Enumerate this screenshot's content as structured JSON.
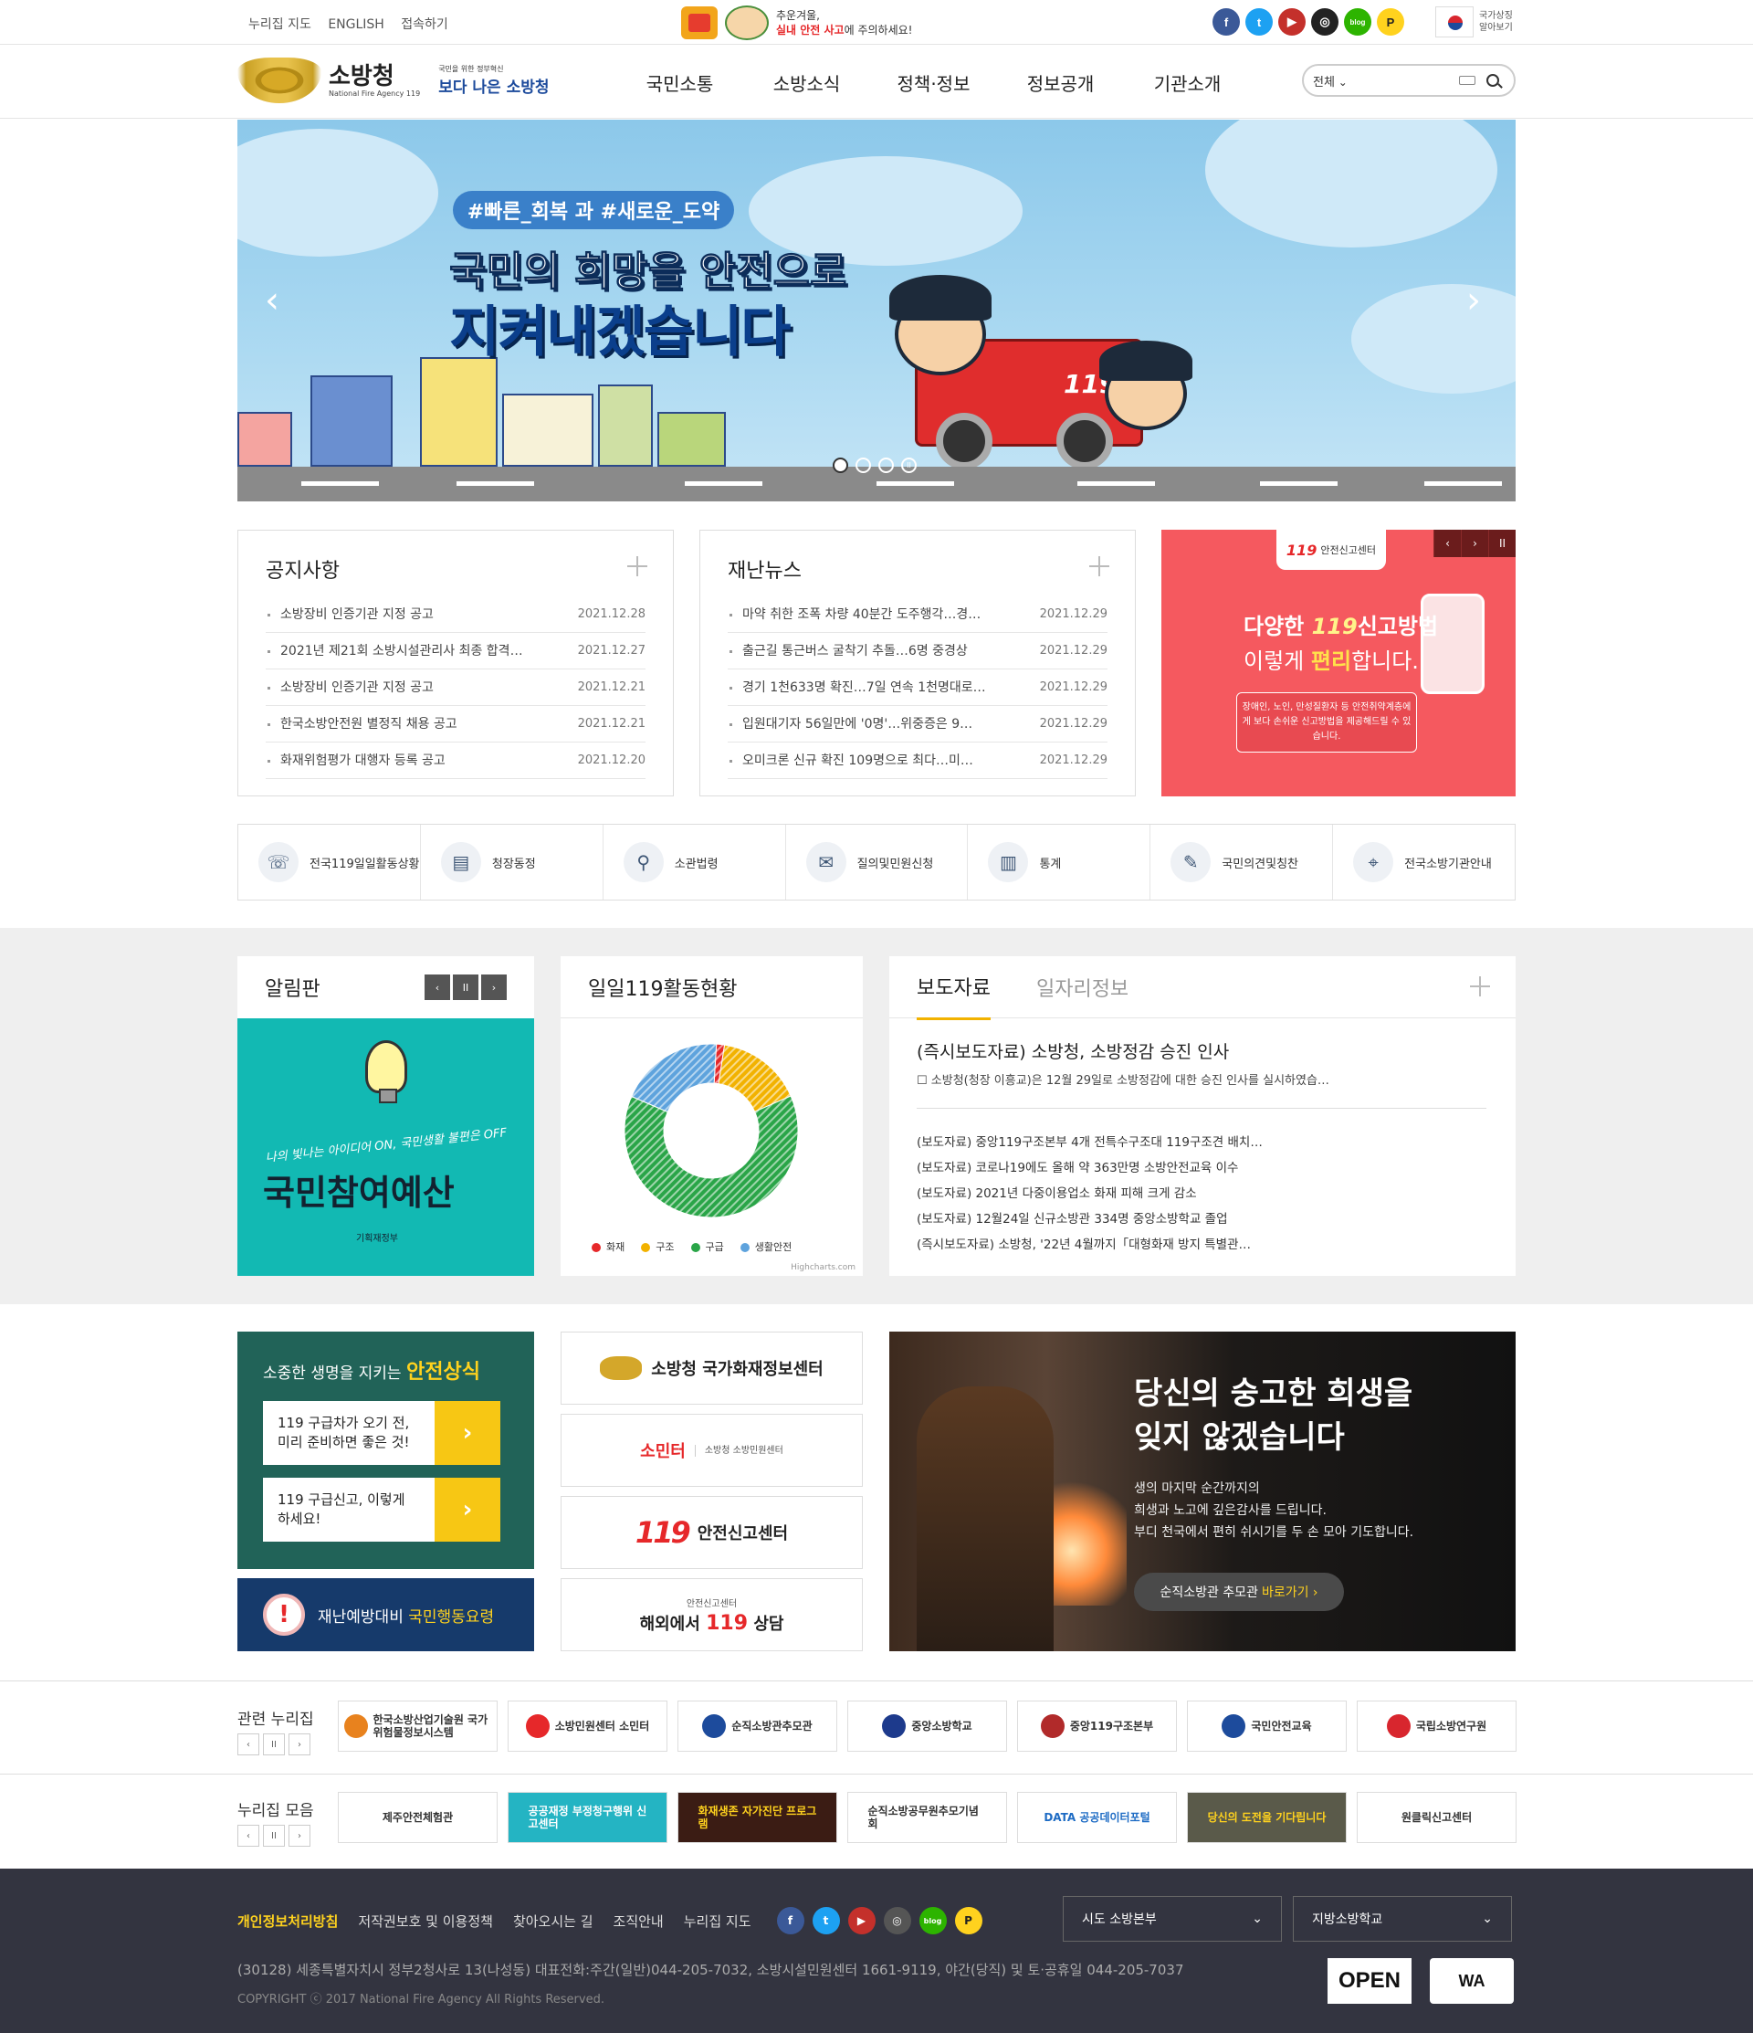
{
  "top": {
    "links": [
      "누리집 지도",
      "ENGLISH",
      "접속하기"
    ],
    "banner_line1": "추운겨울,",
    "banner_line2_red": "실내 안전 사고",
    "banner_line2_rest": "에 주의하세요!",
    "sns": [
      "f",
      "t",
      "▶",
      "◎",
      "blog",
      "P"
    ],
    "national_symbol": "국가상징 알아보기"
  },
  "header": {
    "logo_ko": "소방청",
    "logo_en": "National Fire Agency 119",
    "slogan_small": "국민을 위한 정부혁신",
    "slogan": "보다 나은 소방청",
    "menu": [
      "국민소통",
      "소방소식",
      "정책·정보",
      "정보공개",
      "기관소개"
    ],
    "search_scope": "전체",
    "search_placeholder": ""
  },
  "hero": {
    "tag": "#빠른_회복 과 #새로운_도약",
    "line1": "국민의 희망을 안전으로",
    "line2": "지켜내겠습니다",
    "prev": "‹",
    "next": "›",
    "truck_label": "119"
  },
  "notices": {
    "title": "공지사항",
    "items": [
      {
        "t": "소방장비 인증기관 지정 공고",
        "d": "2021.12.28"
      },
      {
        "t": "2021년 제21회 소방시설관리사 최종 합격…",
        "d": "2021.12.27"
      },
      {
        "t": "소방장비 인증기관 지정 공고",
        "d": "2021.12.21"
      },
      {
        "t": "한국소방안전원 별정직 채용 공고",
        "d": "2021.12.21"
      },
      {
        "t": "화재위험평가 대행자 등록 공고",
        "d": "2021.12.20"
      }
    ]
  },
  "news": {
    "title": "재난뉴스",
    "items": [
      {
        "t": "마약 취한 조폭 차량 40분간 도주행각…경…",
        "d": "2021.12.29"
      },
      {
        "t": "출근길 통근버스 굴착기 추돌…6명 중경상",
        "d": "2021.12.29"
      },
      {
        "t": "경기 1천633명 확진…7일 연속 1천명대로…",
        "d": "2021.12.29"
      },
      {
        "t": "입원대기자 56일만에 '0명'…위중증은 9…",
        "d": "2021.12.29"
      },
      {
        "t": "오미크론 신규 확진 109명으로 최다…미…",
        "d": "2021.12.29"
      }
    ]
  },
  "promo": {
    "badge_num": "119",
    "badge": "안전신고센터",
    "line1_a": "다양한",
    "line1_num": "119",
    "line1_b": "신고방법",
    "line2_a": "이렇게",
    "line2_hl": "편리",
    "line2_b": "합니다.",
    "box": "장애인, 노인, 만성질환자 등 안전취약계층에게 보다 손쉬운 신고방법을 제공해드릴 수 있습니다.",
    "ctrl": [
      "‹",
      "›",
      "II"
    ]
  },
  "quick": [
    {
      "icon": "☏",
      "label": "전국119일일활동상황"
    },
    {
      "icon": "▤",
      "label": "청장동정"
    },
    {
      "icon": "⚲",
      "label": "소관법령"
    },
    {
      "icon": "✉",
      "label": "질의및민원신청"
    },
    {
      "icon": "▥",
      "label": "통계"
    },
    {
      "icon": "✎",
      "label": "국민의견및칭찬"
    },
    {
      "icon": "⌖",
      "label": "전국소방기관안내"
    }
  ],
  "board": {
    "title": "알림판",
    "ctrl": [
      "‹",
      "II",
      "›"
    ],
    "sub": "나의 빛나는 아이디어 ON, 국민생활 불편은 OFF",
    "main": "국민참여예산",
    "org": "기획재정부"
  },
  "activity": {
    "title": "일일119활동현황",
    "credit": "Highcharts.com"
  },
  "chart_data": {
    "type": "pie",
    "title": "",
    "donut": true,
    "categories": [
      "화재",
      "구조",
      "구급",
      "생활안전"
    ],
    "values": [
      1.5,
      16,
      63,
      19.5
    ],
    "colors": [
      "#e6282a",
      "#f2b200",
      "#2aa548",
      "#5ea3dd"
    ]
  },
  "press": {
    "tab_active": "보도자료",
    "tab_inactive": "일자리정보",
    "headline": "(즉시보도자료) 소방청, 소방정감 승진 인사",
    "summary": "☐ 소방청(청장 이흥교)은 12월 29일로 소방정감에 대한 승진 인사를 실시하였습…",
    "items": [
      "(보도자료) 중앙119구조본부 4개 전특수구조대 119구조견 배치…",
      "(보도자료) 코로나19에도 올해 약 363만명 소방안전교육 이수",
      "(보도자료) 2021년 다중이용업소 화재 피해 크게 감소",
      "(보도자료) 12월24일 신규소방관 334명 중앙소방학교 졸업",
      "(즉시보도자료) 소방청, '22년 4월까지「대형화재 방지 특별관…"
    ]
  },
  "safety": {
    "title_a": "소중한 생명을 지키는",
    "title_b": "안전상식",
    "items": [
      {
        "text": "119 구급차가 오기 전, 미리 준비하면 좋은 것!",
        "go": "›"
      },
      {
        "text": "119 구급신고, 이렇게 하세요!",
        "go": "›"
      }
    ]
  },
  "disaster": {
    "mark": "!",
    "a": "재난예방대비",
    "b": "국민행동요령"
  },
  "link_banners": {
    "fire_info": "소방청 국가화재정보센터",
    "somin": "소민터",
    "somin_sub": "소방청 소방민원센터",
    "safety119_num": "119",
    "safety119": "안전신고센터",
    "overseas_small": "안전신고센터",
    "overseas_a": "해외에서",
    "overseas_num": "119",
    "overseas_b": "상담"
  },
  "memorial": {
    "line1": "당신의 숭고한 희생을",
    "line2": "잊지 않겠습니다",
    "body1": "생의 마지막 순간까지의",
    "body2": "희생과 노고에 깊은감사를 드립니다.",
    "body3": "부디 천국에서 편히 쉬시기를 두 손 모아 기도합니다.",
    "btn_a": "순직소방관 추모관",
    "btn_b": "바로가기 ›"
  },
  "related": {
    "title": "관련 누리집",
    "ctrl": [
      "‹",
      "II",
      "›"
    ],
    "items": [
      {
        "label": "한국소방산업기술원 국가위험물정보시스템",
        "color": "#e8821e"
      },
      {
        "label": "소방민원센터 소민터",
        "color": "#e6282a"
      },
      {
        "label": "순직소방관추모관",
        "color": "#1d4b9c"
      },
      {
        "label": "중앙소방학교",
        "color": "#1d3a8c"
      },
      {
        "label": "중앙119구조본부",
        "color": "#b12a2a"
      },
      {
        "label": "국민안전교육",
        "color": "#1d4b9c"
      },
      {
        "label": "국립소방연구원",
        "color": "#d8262e"
      }
    ]
  },
  "collection": {
    "title": "누리집 모음",
    "ctrl": [
      "‹",
      "II",
      "›"
    ],
    "items": [
      {
        "label": "제주안전체험관",
        "bg": "#ffffff",
        "fg": "#333333"
      },
      {
        "label": "공공재정 부정청구행위 신고센터",
        "bg": "#24b4c3",
        "fg": "#ffffff"
      },
      {
        "label": "화재생존 자가진단 프로그램",
        "bg": "#3b1c14",
        "fg": "#ffd21e"
      },
      {
        "label": "순직소방공무원추모기념회",
        "bg": "#ffffff",
        "fg": "#333333"
      },
      {
        "label": "DATA 공공데이터포털",
        "bg": "#ffffff",
        "fg": "#1d6bc4"
      },
      {
        "label": "당신의 도전을 기다립니다",
        "bg": "#5a5a4a",
        "fg": "#ffd21e"
      },
      {
        "label": "원클릭신고센터",
        "bg": "#ffffff",
        "fg": "#333333"
      }
    ]
  },
  "footer": {
    "links": [
      "개인정보처리방침",
      "저작권보호 및 이용정책",
      "찾아오시는 길",
      "조직안내",
      "누리집 지도"
    ],
    "sns": [
      "f",
      "t",
      "▶",
      "◎",
      "blog",
      "P"
    ],
    "select1": "시도 소방본부",
    "select2": "지방소방학교",
    "address": "(30128) 세종특별자치시 정부2청사로 13(나성동) 대표전화:주간(일반)044-205-7032, 소방시설민원센터 1661-9119, 야간(당직) 및 토·공휴일 044-205-7037",
    "copyright": "COPYRIGHT ⓒ 2017 National Fire Agency All Rights Reserved.",
    "badge1": "OPEN",
    "badge2": "WA"
  }
}
